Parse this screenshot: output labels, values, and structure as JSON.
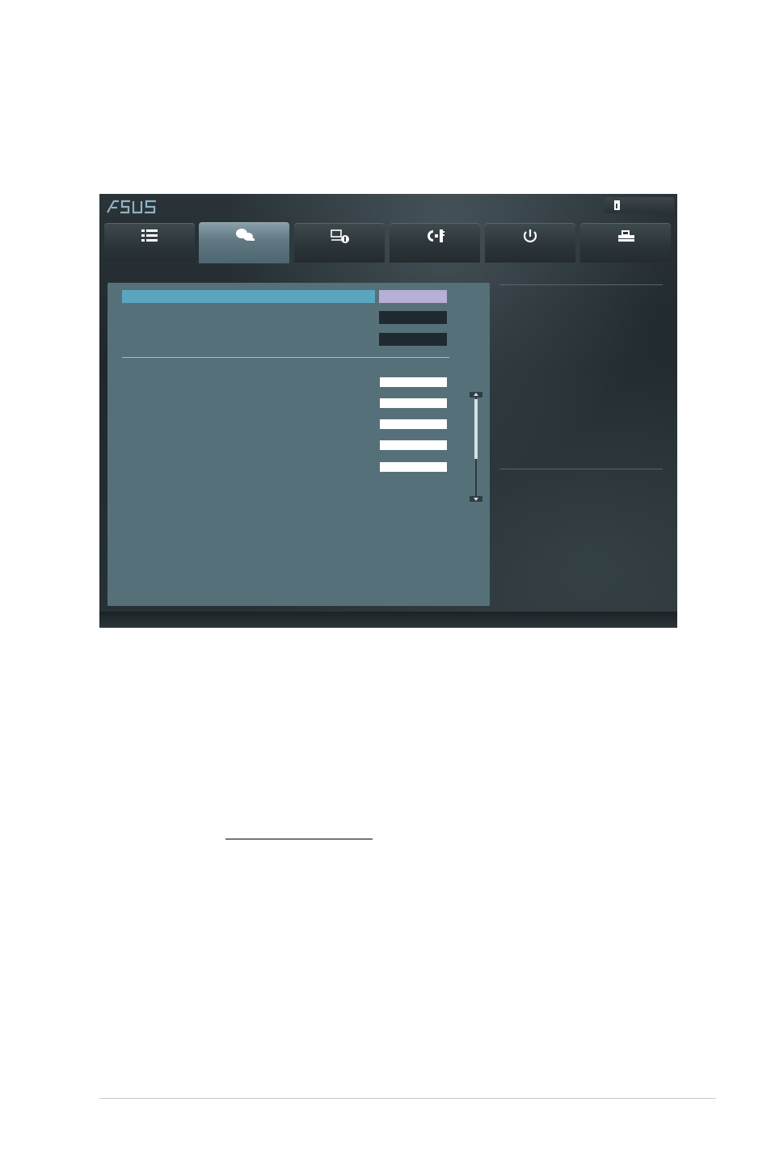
{
  "header": {
    "logo_text": "ASUS",
    "exit_icon": "exit-door-icon"
  },
  "tabs": [
    {
      "icon": "main-list-icon",
      "active": false
    },
    {
      "icon": "ai-tweaker-icon",
      "active": true
    },
    {
      "icon": "advanced-icon",
      "active": false
    },
    {
      "icon": "monitor-icon",
      "active": false
    },
    {
      "icon": "boot-power-icon",
      "active": false
    },
    {
      "icon": "tool-icon",
      "active": false
    }
  ],
  "colors": {
    "panel": "#56707a",
    "highlight_row": "#5aa6bf",
    "selected_value": "#b7afd4",
    "dark_value": "#1f2a30",
    "white_value": "#ffffff"
  }
}
